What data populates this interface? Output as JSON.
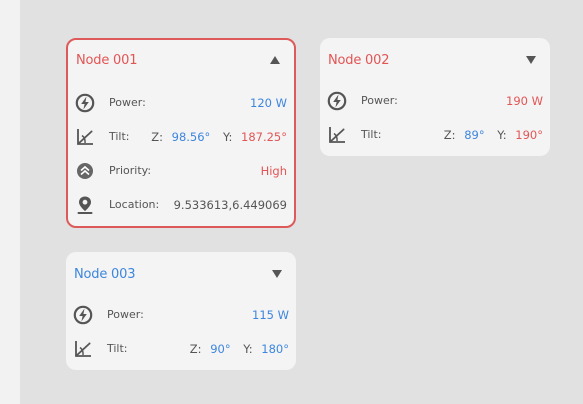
{
  "colors": {
    "blue": "#3d86de",
    "red": "#e25555",
    "selected_border": "#de5a5a",
    "card_bg": "#f4f4f4",
    "canvas_bg": "#e1e1e1"
  },
  "nodes": [
    {
      "title": "Node 001",
      "expanded": true,
      "selected": true,
      "toggle_icon": "triangle-up-icon",
      "power_label": "Power:",
      "power_value": "120 W",
      "tilt_label": "Tilt:",
      "tilt_z_label": "Z:",
      "tilt_z_value": "98.56°",
      "tilt_y_label": "Y:",
      "tilt_y_value": "187.25°",
      "priority_label": "Priority:",
      "priority_value": "High",
      "location_label": "Location:",
      "location_value": "9.533613,6.449069"
    },
    {
      "title": "Node 002",
      "expanded": false,
      "selected": false,
      "toggle_icon": "triangle-down-icon",
      "power_label": "Power:",
      "power_value": "190 W",
      "tilt_label": "Tilt:",
      "tilt_z_label": "Z:",
      "tilt_z_value": "89°",
      "tilt_y_label": "Y:",
      "tilt_y_value": "190°"
    },
    {
      "title": "Node 003",
      "expanded": false,
      "selected": false,
      "toggle_icon": "triangle-down-icon",
      "power_label": "Power:",
      "power_value": "115 W",
      "tilt_label": "Tilt:",
      "tilt_z_label": "Z:",
      "tilt_z_value": "90°",
      "tilt_y_label": "Y:",
      "tilt_y_value": "180°"
    }
  ]
}
